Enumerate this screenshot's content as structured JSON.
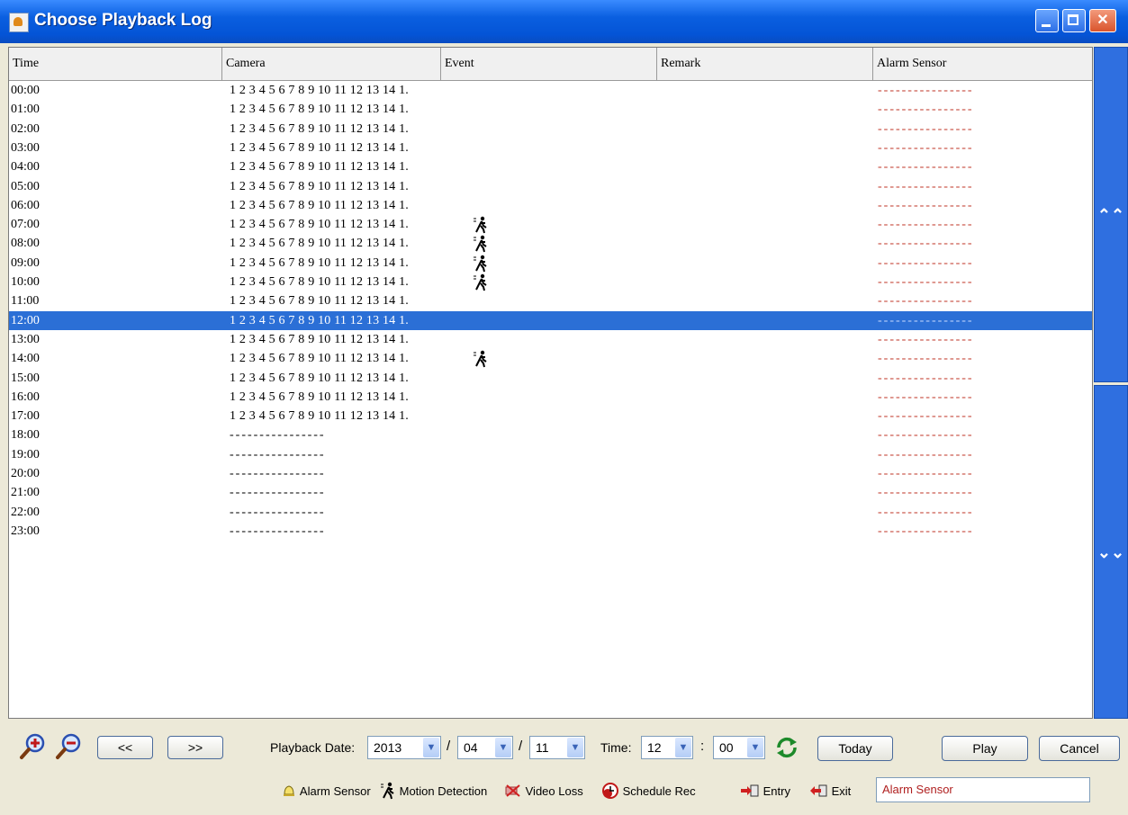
{
  "window": {
    "title": "Choose Playback Log"
  },
  "table": {
    "columns": [
      "Time",
      "Camera",
      "Event",
      "Remark",
      "Alarm Sensor"
    ],
    "rows": [
      {
        "time": "00:00",
        "camera": "1 2 3 4 5 6 7 8 9 10 11 12 13 14 1.",
        "event": "",
        "alarm": "----------------"
      },
      {
        "time": "01:00",
        "camera": "1 2 3 4 5 6 7 8 9 10 11 12 13 14 1.",
        "event": "",
        "alarm": "----------------"
      },
      {
        "time": "02:00",
        "camera": "1 2 3 4 5 6 7 8 9 10 11 12 13 14 1.",
        "event": "",
        "alarm": "----------------"
      },
      {
        "time": "03:00",
        "camera": "1 2 3 4 5 6 7 8 9 10 11 12 13 14 1.",
        "event": "",
        "alarm": "----------------"
      },
      {
        "time": "04:00",
        "camera": "1 2 3 4 5 6 7 8 9 10 11 12 13 14 1.",
        "event": "",
        "alarm": "----------------"
      },
      {
        "time": "05:00",
        "camera": "1 2 3 4 5 6 7 8 9 10 11 12 13 14 1.",
        "event": "",
        "alarm": "----------------"
      },
      {
        "time": "06:00",
        "camera": "1 2 3 4 5 6 7 8 9 10 11 12 13 14 1.",
        "event": "",
        "alarm": "----------------"
      },
      {
        "time": "07:00",
        "camera": "1 2 3 4 5 6 7 8 9 10 11 12 13 14 1.",
        "event": "motion-detection-icon",
        "alarm": "----------------"
      },
      {
        "time": "08:00",
        "camera": "1 2 3 4 5 6 7 8 9 10 11 12 13 14 1.",
        "event": "motion-detection-icon",
        "alarm": "----------------"
      },
      {
        "time": "09:00",
        "camera": "1 2 3 4 5 6 7 8 9 10 11 12 13 14 1.",
        "event": "motion-detection-icon",
        "alarm": "----------------"
      },
      {
        "time": "10:00",
        "camera": "1 2 3 4 5 6 7 8 9 10 11 12 13 14 1.",
        "event": "motion-detection-icon",
        "alarm": "----------------"
      },
      {
        "time": "11:00",
        "camera": "1 2 3 4 5 6 7 8 9 10 11 12 13 14 1.",
        "event": "",
        "alarm": "----------------"
      },
      {
        "time": "12:00",
        "camera": "1 2 3 4 5 6 7 8 9 10 11 12 13 14 1.",
        "event": "",
        "alarm": "----------------",
        "selected": true
      },
      {
        "time": "13:00",
        "camera": "1 2 3 4 5 6 7 8 9 10 11 12 13 14 1.",
        "event": "",
        "alarm": "----------------"
      },
      {
        "time": "14:00",
        "camera": "1 2 3 4 5 6 7 8 9 10 11 12 13 14 1.",
        "event": "motion-detection-icon",
        "alarm": "----------------"
      },
      {
        "time": "15:00",
        "camera": "1 2 3 4 5 6 7 8 9 10 11 12 13 14 1.",
        "event": "",
        "alarm": "----------------"
      },
      {
        "time": "16:00",
        "camera": "1 2 3 4 5 6 7 8 9 10 11 12 13 14 1.",
        "event": "",
        "alarm": "----------------"
      },
      {
        "time": "17:00",
        "camera": "1 2 3 4 5 6 7 8 9 10 11 12 13 14 1.",
        "event": "",
        "alarm": "----------------"
      },
      {
        "time": "18:00",
        "camera": "----------------",
        "event": "",
        "alarm": "----------------"
      },
      {
        "time": "19:00",
        "camera": "----------------",
        "event": "",
        "alarm": "----------------"
      },
      {
        "time": "20:00",
        "camera": "----------------",
        "event": "",
        "alarm": "----------------"
      },
      {
        "time": "21:00",
        "camera": "----------------",
        "event": "",
        "alarm": "----------------"
      },
      {
        "time": "22:00",
        "camera": "----------------",
        "event": "",
        "alarm": "----------------"
      },
      {
        "time": "23:00",
        "camera": "----------------",
        "event": "",
        "alarm": "----------------"
      }
    ]
  },
  "scroll": {
    "up_icon": "double-chevron-up-icon",
    "down_icon": "double-chevron-down-icon"
  },
  "controls": {
    "zoom_in_icon": "zoom-in-icon",
    "zoom_out_icon": "zoom-out-icon",
    "prev_label": "<<",
    "next_label": ">>",
    "playback_date_label": "Playback Date:",
    "year": "2013",
    "month": "04",
    "day": "11",
    "date_separator": "/",
    "time_label": "Time:",
    "hour": "12",
    "time_separator": ":",
    "minute": "00",
    "refresh_icon": "refresh-icon",
    "today_label": "Today",
    "play_label": "Play",
    "cancel_label": "Cancel"
  },
  "legend": {
    "alarm_sensor": "Alarm Sensor",
    "motion_detection": "Motion Detection",
    "video_loss": "Video Loss",
    "schedule_rec": "Schedule Rec",
    "entry": "Entry",
    "exit": "Exit",
    "filter_value": "Alarm Sensor"
  },
  "colors": {
    "titlebar": "#0454d6",
    "selection": "#2b6fd6",
    "scrollbar": "#2f6fe0",
    "alarm_dash": "#c0392b"
  }
}
